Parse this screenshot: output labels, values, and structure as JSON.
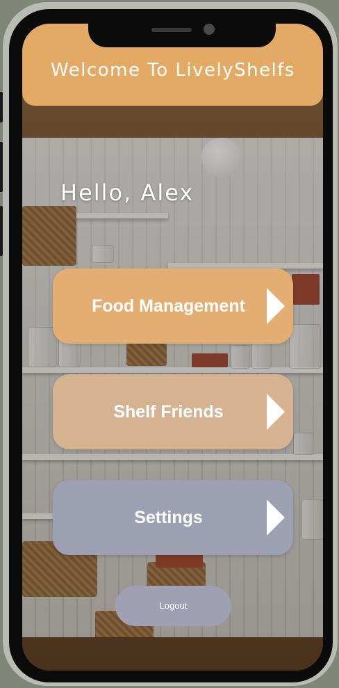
{
  "app": {
    "title": "Welcome To LivelyShelfs"
  },
  "home": {
    "greeting": "Hello, Alex"
  },
  "menu": {
    "items": [
      {
        "label": "Food Management",
        "color": "#e4ae73",
        "icon": "chevron-right-icon"
      },
      {
        "label": "Shelf Friends",
        "color": "#d6b390",
        "icon": "chevron-right-icon"
      },
      {
        "label": "Settings",
        "color": "#9d9fb2",
        "icon": "chevron-right-icon"
      }
    ]
  },
  "footer": {
    "logout_label": "Logout"
  },
  "theme": {
    "header_color": "#e3aa66",
    "logout_color": "#9fa0b3",
    "text_color": "#ffffff"
  }
}
